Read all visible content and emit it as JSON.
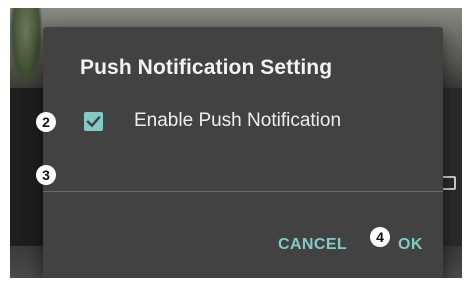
{
  "dialog": {
    "title": "Push Notification Setting",
    "checkbox": {
      "label": "Enable Push Notification",
      "checked": true
    },
    "buttons": {
      "cancel": "CANCEL",
      "ok": "OK"
    }
  },
  "annotations": {
    "badge_2": "2",
    "badge_3": "3",
    "badge_4": "4"
  },
  "colors": {
    "dialog_background": "#424242",
    "accent": "#80cbc4",
    "title_text": "#f2f2f2",
    "body_text": "#eeeeee"
  },
  "icons": {
    "checkbox": "check-icon"
  }
}
